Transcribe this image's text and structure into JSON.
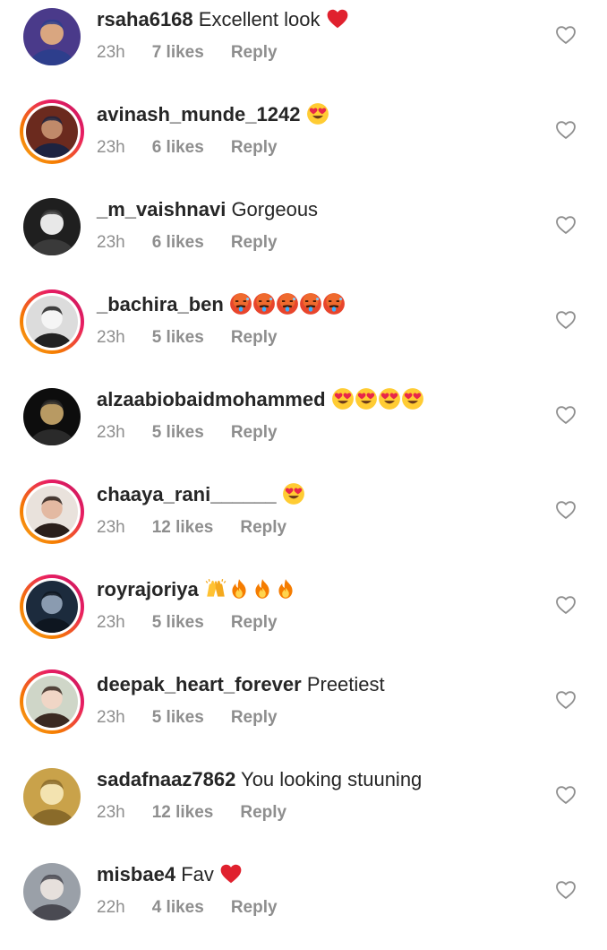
{
  "comments": [
    {
      "username": "rsaha6168",
      "text": "Excellent look",
      "emoji": [
        "red-heart"
      ],
      "time": "23h",
      "likes": "7 likes",
      "reply": "Reply",
      "ring": false,
      "avatar": {
        "bg": "#4a3a8a",
        "fg": "#d9a680",
        "shirt": "#2d3e8c"
      }
    },
    {
      "username": "avinash_munde_1242",
      "text": "",
      "emoji": [
        "heart-eyes"
      ],
      "time": "23h",
      "likes": "6 likes",
      "reply": "Reply",
      "ring": true,
      "avatar": {
        "bg": "#6b2a1e",
        "fg": "#c08a6a",
        "shirt": "#1d2340"
      }
    },
    {
      "username": "_m_vaishnavi",
      "text": "Gorgeous",
      "emoji": [],
      "time": "23h",
      "likes": "6 likes",
      "reply": "Reply",
      "ring": false,
      "avatar": {
        "bg": "#1f1f1f",
        "fg": "#e8e8e8",
        "shirt": "#3a3a3a"
      }
    },
    {
      "username": "_bachira_ben",
      "text": "",
      "emoji": [
        "hot-face",
        "hot-face",
        "hot-face",
        "hot-face",
        "hot-face"
      ],
      "time": "23h",
      "likes": "5 likes",
      "reply": "Reply",
      "ring": true,
      "avatar": {
        "bg": "#dcdcdc",
        "fg": "#f5f5f5",
        "shirt": "#222222"
      }
    },
    {
      "username": "alzaabiobaidmohammed",
      "text": "",
      "emoji": [
        "heart-eyes",
        "heart-eyes",
        "heart-eyes",
        "heart-eyes"
      ],
      "time": "23h",
      "likes": "5 likes",
      "reply": "Reply",
      "ring": false,
      "avatar": {
        "bg": "#0d0d0d",
        "fg": "#b89a63",
        "shirt": "#2a2a2a"
      }
    },
    {
      "username": "chaaya_rani______",
      "text": "",
      "emoji": [
        "heart-eyes"
      ],
      "time": "23h",
      "likes": "12 likes",
      "reply": "Reply",
      "ring": true,
      "avatar": {
        "bg": "#e9e2dc",
        "fg": "#e3b9a2",
        "shirt": "#2b1f1a"
      }
    },
    {
      "username": "royrajoriya",
      "text": "",
      "emoji": [
        "raising-hands",
        "fire",
        "fire",
        "fire"
      ],
      "time": "23h",
      "likes": "5 likes",
      "reply": "Reply",
      "ring": true,
      "avatar": {
        "bg": "#1c2b3d",
        "fg": "#8a9bb0",
        "shirt": "#0e1620"
      }
    },
    {
      "username": "deepak_heart_forever",
      "text": "Preetiest",
      "emoji": [],
      "time": "23h",
      "likes": "5 likes",
      "reply": "Reply",
      "ring": true,
      "avatar": {
        "bg": "#cfd6c8",
        "fg": "#f0d6c6",
        "shirt": "#3b2a22"
      }
    },
    {
      "username": "sadafnaaz7862",
      "text": "You looking stuuning",
      "emoji": [],
      "time": "23h",
      "likes": "12 likes",
      "reply": "Reply",
      "ring": false,
      "avatar": {
        "bg": "#c9a24a",
        "fg": "#f3e3b0",
        "shirt": "#8a6b2a"
      }
    },
    {
      "username": "misbae4",
      "text": "Fav",
      "emoji": [
        "red-heart"
      ],
      "time": "22h",
      "likes": "4 likes",
      "reply": "Reply",
      "ring": false,
      "avatar": {
        "bg": "#9aa0a8",
        "fg": "#e6e0dc",
        "shirt": "#4a4a52"
      }
    }
  ],
  "colors": {
    "username": "#262626",
    "meta": "#8e8e8e",
    "heart_icon": "#8e8e8e",
    "ring_start": "#f9a825",
    "ring_end": "#c2185b"
  }
}
